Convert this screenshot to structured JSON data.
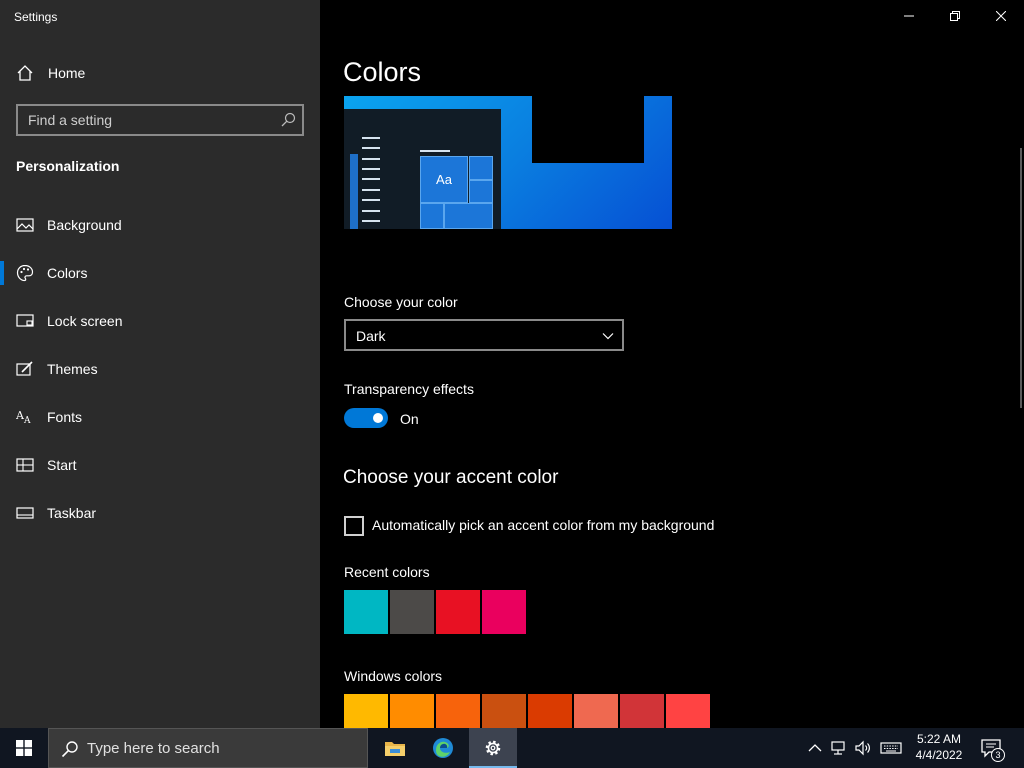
{
  "window": {
    "title": "Settings"
  },
  "sidebar": {
    "home_label": "Home",
    "search_placeholder": "Find a setting",
    "section_title": "Personalization",
    "items": [
      {
        "label": "Background",
        "icon": "image-icon"
      },
      {
        "label": "Colors",
        "icon": "palette-icon",
        "selected": true
      },
      {
        "label": "Lock screen",
        "icon": "lock-screen-icon"
      },
      {
        "label": "Themes",
        "icon": "brush-icon"
      },
      {
        "label": "Fonts",
        "icon": "font-icon"
      },
      {
        "label": "Start",
        "icon": "start-icon"
      },
      {
        "label": "Taskbar",
        "icon": "taskbar-icon"
      }
    ]
  },
  "main": {
    "page_title": "Colors",
    "preview_sample_text": "Aa",
    "choose_color_label": "Choose your color",
    "choose_color_value": "Dark",
    "transparency_label": "Transparency effects",
    "transparency_state": "On",
    "accent_heading": "Choose your accent color",
    "auto_accent_label": "Automatically pick an accent color from my background",
    "auto_accent_checked": false,
    "recent_colors_label": "Recent colors",
    "recent_colors": [
      "#00b7c3",
      "#4c4a48",
      "#e81123",
      "#ea005e"
    ],
    "windows_colors_label": "Windows colors",
    "windows_colors": [
      "#ffb900",
      "#ff8c00",
      "#f7630c",
      "#ca5010",
      "#da3b01",
      "#ef6950",
      "#d13438",
      "#ff4343"
    ]
  },
  "theme": {
    "accent": "#0078d7",
    "sidebar_bg": "#2b2b2b",
    "main_bg": "#000000",
    "taskbar_bg": "#101621"
  },
  "taskbar": {
    "search_placeholder": "Type here to search",
    "apps": [
      {
        "name": "file-explorer-icon"
      },
      {
        "name": "edge-icon"
      },
      {
        "name": "settings-gear-icon",
        "active": true
      }
    ],
    "time": "5:22 AM",
    "date": "4/4/2022",
    "notification_count": "3"
  }
}
